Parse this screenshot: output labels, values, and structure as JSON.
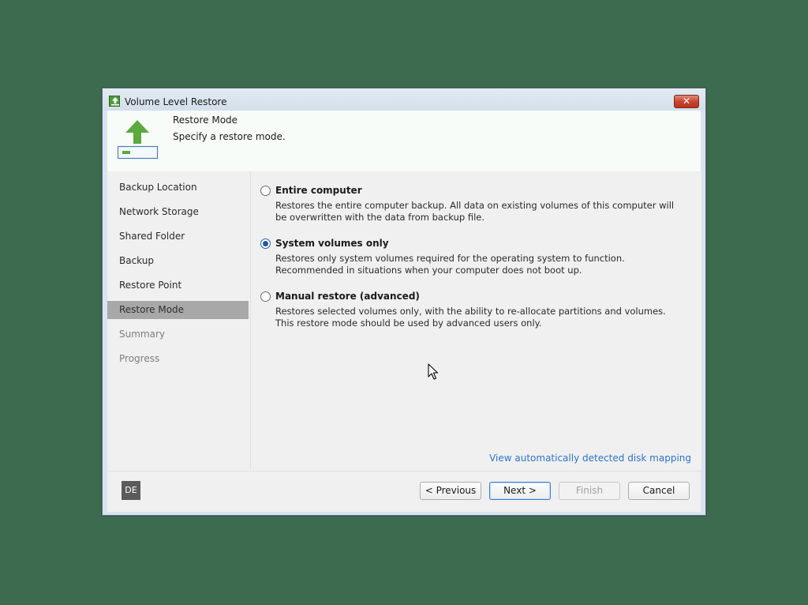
{
  "window": {
    "title": "Volume Level Restore",
    "close_symbol": "✕"
  },
  "header": {
    "title": "Restore Mode",
    "subtitle": "Specify a restore mode."
  },
  "sidebar": {
    "items": [
      {
        "label": "Backup Location",
        "state": "normal"
      },
      {
        "label": "Network Storage",
        "state": "normal"
      },
      {
        "label": "Shared Folder",
        "state": "normal"
      },
      {
        "label": "Backup",
        "state": "normal"
      },
      {
        "label": "Restore Point",
        "state": "normal"
      },
      {
        "label": "Restore Mode",
        "state": "active"
      },
      {
        "label": "Summary",
        "state": "disabled"
      },
      {
        "label": "Progress",
        "state": "disabled"
      }
    ]
  },
  "options": [
    {
      "label": "Entire computer",
      "selected": false,
      "description": "Restores the entire computer backup. All data on existing volumes of this computer will be overwritten with the data from backup file."
    },
    {
      "label": "System volumes only",
      "selected": true,
      "description": "Restores only system volumes required for the operating system to function. Recommended in situations when your computer does not boot up."
    },
    {
      "label": "Manual restore (advanced)",
      "selected": false,
      "description": "Restores selected volumes only, with the ability to re-allocate partitions and volumes. This restore mode should be used by advanced users only."
    }
  ],
  "link": {
    "label": "View automatically detected disk mapping"
  },
  "footer": {
    "language_badge": "DE",
    "buttons": {
      "previous": "< Previous",
      "next": "Next >",
      "finish": "Finish",
      "cancel": "Cancel"
    }
  },
  "colors": {
    "desktop": "#3d6b50",
    "accent": "#2357a0",
    "link": "#2d74c8",
    "close_button": "#c6412a",
    "header_arrow": "#5aaa3c"
  },
  "icons": {
    "window": "restore-arrow-icon",
    "header": "restore-arrow-drive-icon",
    "cursor": "mouse-pointer-icon"
  }
}
